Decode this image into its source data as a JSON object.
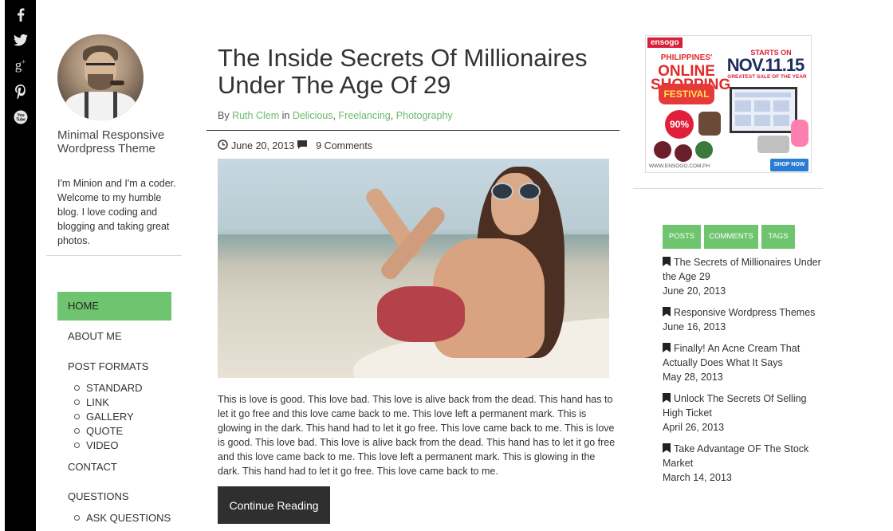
{
  "social": {
    "icons": [
      "facebook-icon",
      "twitter-icon",
      "google-plus-icon",
      "pinterest-icon",
      "youtube-icon"
    ]
  },
  "sidebar": {
    "site_title": "Minimal Responsive Wordpress Theme",
    "description": "I'm Minion and I'm a coder. Welcome to my humble blog. I love coding and blogging and taking great photos.",
    "nav": {
      "home": "HOME",
      "about": "ABOUT ME",
      "post_formats": "POST FORMATS",
      "sub_formats": [
        "STANDARD",
        "LINK",
        "GALLERY",
        "QUOTE",
        "VIDEO"
      ],
      "contact": "CONTACT",
      "questions": "QUESTIONS",
      "ask_questions": "ASK QUESTIONS"
    }
  },
  "post": {
    "title": "The Inside Secrets Of Millionaires Under The Age Of 29",
    "by": "By",
    "author": "Ruth Clem",
    "in": "in",
    "categories": [
      "Delicious",
      "Freelancing",
      "Photography"
    ],
    "date": "June 20, 2013",
    "comments": "9 Comments",
    "excerpt": "This is love is good. This love bad. This love is alive back from the dead. This hand has to let it go free and this love came back to me. This love left a permanent mark. This is glowing in the dark. This hand had to let it go free. This love came back to me. This is love is good. This love bad. This love is alive back from the dead. This hand has to let it go free and this love came back to me. This love left a permanent mark. This is glowing in the dark. This hand had to let it go free. This love came back to me.",
    "continue_label": "Continue Reading"
  },
  "ad": {
    "brand": "ensogo",
    "country": "PHILIPPINES'",
    "headline": "ONLINE SHOPPING",
    "festival": "FESTIVAL",
    "starts_on": "STARTS ON",
    "date": "NOV.11.15",
    "tagline": "GREATEST SALE OF THE YEAR",
    "discount": "90%",
    "url": "WWW.ENSOGO.COM.PH",
    "shop_now": "SHOP NOW"
  },
  "widget": {
    "tabs": [
      "POSTS",
      "COMMENTS",
      "TAGS"
    ],
    "recent_posts": [
      {
        "title": "The Secrets of Millionaires Under the Age 29",
        "date": "June 20, 2013"
      },
      {
        "title": "Responsive Wordpress Themes",
        "date": "June 16, 2013"
      },
      {
        "title": "Finally! An Acne Cream That Actually Does What It Says",
        "date": "May 28, 2013"
      },
      {
        "title": "Unlock The Secrets Of Selling High Ticket",
        "date": "April 26, 2013"
      },
      {
        "title": "Take Advantage OF The Stock Market",
        "date": "March 14, 2013"
      }
    ]
  },
  "colors": {
    "accent": "#6fc46f",
    "link": "#6ab96a",
    "dark": "#2f2f2f",
    "social_bar": "#000000"
  }
}
